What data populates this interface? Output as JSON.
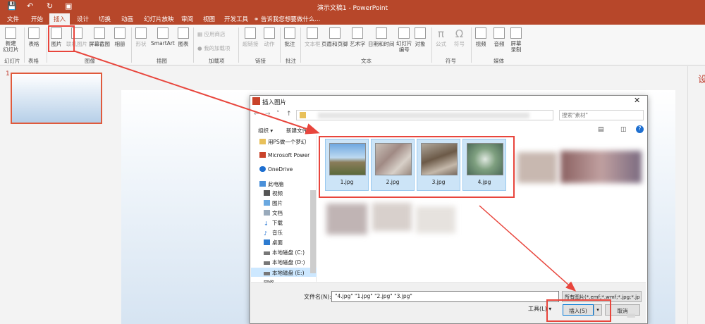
{
  "window": {
    "title": "演示文稿1 - PowerPoint"
  },
  "tabs": [
    "文件",
    "开始",
    "插入",
    "设计",
    "切换",
    "动画",
    "幻灯片放映",
    "审阅",
    "视图",
    "开发工具"
  ],
  "tell_me": "告诉我您想要做什么...",
  "ribbon": {
    "new_slide": "新建\n幻灯片",
    "table": "表格",
    "picture": "图片",
    "online_picture": "联机图片",
    "screenshot": "屏幕截图",
    "album": "相册",
    "shapes": "形状",
    "smartart": "SmartArt",
    "chart": "图表",
    "app_store": "应用商店",
    "my_addins": "我的加载项",
    "hyperlink": "超链接",
    "action": "动作",
    "comment": "批注",
    "textbox": "文本框",
    "header_footer": "页眉和页脚",
    "wordart": "艺术字",
    "datetime": "日期和时间",
    "slide_number": "幻灯片\n编号",
    "object": "对象",
    "equation": "公式",
    "symbol": "符号",
    "video": "视频",
    "audio": "音频",
    "screen_record": "屏幕\n录制",
    "groups": [
      "幻灯片",
      "表格",
      "图像",
      "插图",
      "加载项",
      "链接",
      "批注",
      "文本",
      "符号",
      "媒体"
    ]
  },
  "slides": {
    "number": "1"
  },
  "right_pane_char": "设",
  "dialog": {
    "title": "插入图片",
    "search_placeholder": "搜索\"素材\"",
    "organize": "组织 ▾",
    "new_folder": "新建文件夹",
    "nav": [
      "用PS做一个梦幻",
      "Microsoft Power",
      "OneDrive",
      "此电脑",
      "视频",
      "图片",
      "文档",
      "下载",
      "音乐",
      "桌面",
      "本地磁盘 (C:)",
      "本地磁盘 (D:)",
      "本地磁盘 (E:)",
      "网络"
    ],
    "files": [
      "1.jpg",
      "2.jpg",
      "3.jpg",
      "4.jpg"
    ],
    "filename_label": "文件名(N):",
    "filename_value": "\"4.jpg\" \"1.jpg\" \"2.jpg\" \"3.jpg\"",
    "filetype": "所有图片(*.emf;*.wmf;*.jpg;*.jp",
    "tools": "工具(L)",
    "insert": "插入(S)",
    "cancel": "取消"
  },
  "colors": {
    "accent": "#b7472a",
    "selection": "#cce4f7",
    "annotation": "#e8453c"
  }
}
